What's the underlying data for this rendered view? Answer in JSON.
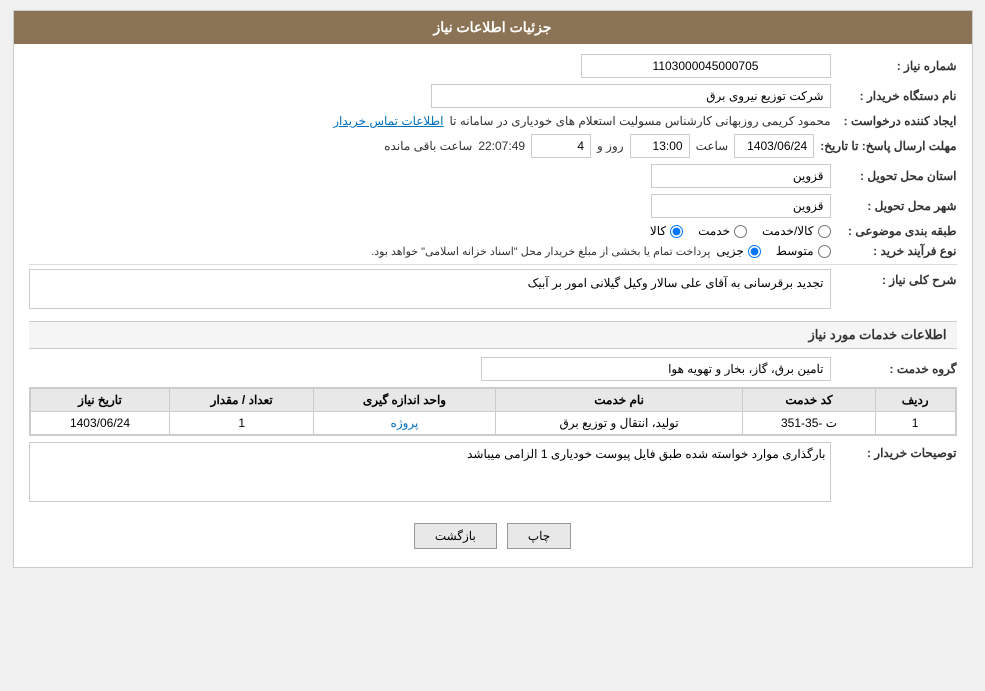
{
  "header": {
    "title": "جزئیات اطلاعات نیاز"
  },
  "fields": {
    "need_number_label": "شماره نیاز :",
    "need_number_value": "1103000045000705",
    "buyer_station_label": "نام دستگاه خریدار :",
    "buyer_station_value": "شرکت توزیع نیروی برق",
    "requester_label": "ایجاد کننده درخواست :",
    "requester_value": "محمود کریمی روزبهانی کارشناس  مسولیت استعلام های خودیاری در سامانه تا",
    "requester_link": "اطلاعات تماس خریدار",
    "deadline_label": "مهلت ارسال پاسخ: تا تاریخ:",
    "deadline_date": "1403/06/24",
    "deadline_time_label": "ساعت",
    "deadline_time": "13:00",
    "deadline_days_label": "روز و",
    "deadline_days": "4",
    "deadline_remaining_label": "ساعت باقی مانده",
    "deadline_remaining": "22:07:49",
    "province_label": "استان محل تحویل :",
    "province_value": "قزوین",
    "city_label": "شهر محل تحویل :",
    "city_value": "قزوین",
    "category_label": "طبقه بندی موضوعی :",
    "category_options": [
      "کالا",
      "خدمت",
      "کالا/خدمت"
    ],
    "category_selected": "کالا",
    "purchase_type_label": "نوع فرآیند خرید :",
    "purchase_type_options": [
      "جزیی",
      "متوسط"
    ],
    "purchase_type_note": "پرداخت تمام یا بخشی از مبلغ خریدار محل \"اسناد خزانه اسلامی\" خواهد بود.",
    "description_label": "شرح کلی نیاز :",
    "description_value": "تجدید برقرسانی به آقای علی سالار وکیل گیلانی امور بر آبیک",
    "services_section": "اطلاعات خدمات مورد نیاز",
    "service_group_label": "گروه خدمت :",
    "service_group_value": "تامین برق، گاز، بخار و تهویه هوا",
    "table": {
      "headers": [
        "ردیف",
        "کد خدمت",
        "نام خدمت",
        "واحد اندازه گیری",
        "تعداد / مقدار",
        "تاریخ نیاز"
      ],
      "rows": [
        {
          "row": "1",
          "code": "ت -35-351",
          "name": "تولید، انتقال و توزیع برق",
          "unit": "پروژه",
          "quantity": "1",
          "date": "1403/06/24"
        }
      ]
    },
    "buyer_notes_label": "توصیحات خریدار :",
    "buyer_notes_value": "بارگذاری موارد خواسته شده طبق فایل پیوست خودیاری 1 الزامی میباشد",
    "btn_back": "بازگشت",
    "btn_print": "چاپ"
  }
}
